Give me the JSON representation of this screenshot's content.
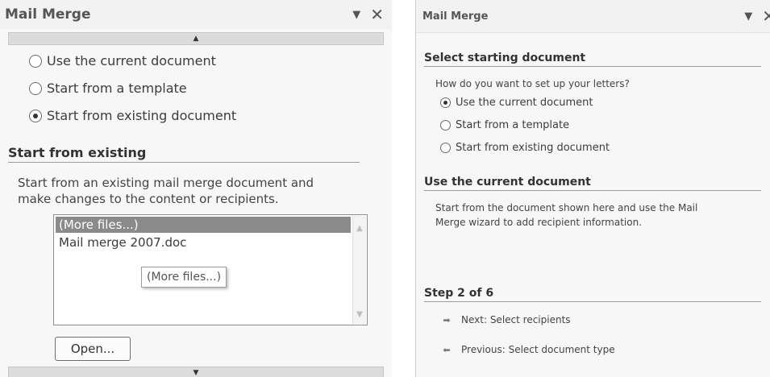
{
  "left_panel": {
    "title": "Mail Merge",
    "title_icons": {
      "dropdown": "▼",
      "close": "✕"
    },
    "scroll_up": "▲",
    "scroll_down": "▼",
    "radio_options": [
      {
        "label": "Use the current document",
        "checked": false
      },
      {
        "label": "Start from a template",
        "checked": false
      },
      {
        "label": "Start from existing document",
        "checked": true
      }
    ],
    "section_heading": "Start from existing",
    "description_line1": "Start from an existing mail merge document and",
    "description_line2": "make changes to the content or recipients.",
    "file_list": {
      "items": [
        "(More files...)",
        "Mail merge 2007.doc"
      ],
      "selected_index": 0,
      "tooltip": "(More files...)",
      "scroll_up": "▲",
      "scroll_down": "▼"
    },
    "open_button": "Open..."
  },
  "right_panel": {
    "title": "Mail Merge",
    "title_icons": {
      "dropdown": "▼",
      "close": "✕"
    },
    "section1_heading": "Select starting document",
    "question": "How do you want to set up your letters?",
    "radio_options": [
      {
        "label": "Use the current document",
        "checked": true
      },
      {
        "label": "Start from a template",
        "checked": false
      },
      {
        "label": "Start from existing document",
        "checked": false
      }
    ],
    "section2_heading": "Use the current document",
    "description_line1": "Start from the document shown here and use the Mail",
    "description_line2": "Merge wizard to add recipient information.",
    "step_heading": "Step 2 of 6",
    "next_arrow": "➡",
    "next_label": "Next: Select recipients",
    "prev_arrow": "⬅",
    "prev_label": "Previous: Select document type"
  }
}
